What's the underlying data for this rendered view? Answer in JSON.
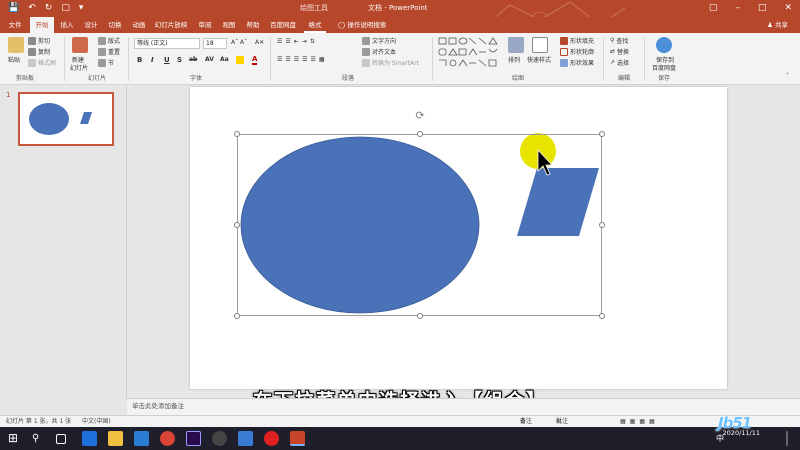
{
  "titlebar": {
    "context_tool": "绘图工具",
    "document": "文档  -  PowerPoint",
    "user": "",
    "qa_icons": [
      "save-icon",
      "undo-icon",
      "redo-icon",
      "present-icon",
      "customize-icon"
    ]
  },
  "tabs": [
    "文件",
    "开始",
    "插入",
    "设计",
    "切换",
    "动画",
    "幻灯片放映",
    "审阅",
    "视图",
    "帮助",
    "百度网盘",
    "格式",
    "操作说明搜索"
  ],
  "active_tab": "开始",
  "share_label": "共享",
  "ribbon": {
    "clipboard": {
      "label": "剪贴板",
      "paste": "粘贴",
      "cut": "剪切",
      "copy": "复制",
      "format_painter": "格式刷"
    },
    "slides": {
      "label": "幻灯片",
      "new_slide": "新建",
      "new_slide_2": "幻灯片",
      "layout": "版式",
      "reset": "重置",
      "section": "节"
    },
    "font": {
      "label": "字体",
      "font_name": "等线 (正文)",
      "font_size": "18",
      "buttons": [
        "B",
        "I",
        "U",
        "S",
        "ab",
        "AV",
        "Aa",
        "A"
      ]
    },
    "paragraph": {
      "label": "段落",
      "text_direction": "文字方向",
      "align_text": "对齐文本",
      "smartart": "转换为 SmartArt"
    },
    "drawing": {
      "label": "绘图",
      "arrange": "排列",
      "quick_styles": "快速样式",
      "fill": "形状填充",
      "outline": "形状轮廓",
      "effects": "形状效果"
    },
    "editing": {
      "label": "编辑",
      "find": "查找",
      "replace": "替换",
      "select": "选择"
    },
    "save": {
      "label": "保存",
      "save_to_baidu": "保存到",
      "save_to_baidu_2": "百度网盘"
    }
  },
  "thumbnail": {
    "number": "1"
  },
  "notes_placeholder": "单击此处添加备注",
  "statusbar": {
    "slide_info": "幻灯片 第 1 张，共 1 张",
    "language": "中文(中国)",
    "notes": "备注",
    "comments": "批注"
  },
  "subtitle": "在下拉菜单中选择进入【组合】",
  "taskbar": {
    "time": "",
    "date": "2020/11/11",
    "lang": "中"
  },
  "watermark": "Jb51",
  "colors": {
    "accent": "#b7472a",
    "shape": "#4a72b8",
    "pointer_highlight": "#e8e400"
  }
}
